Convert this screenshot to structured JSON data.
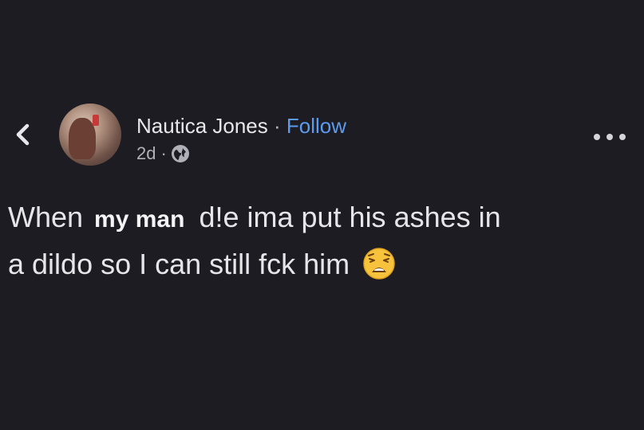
{
  "post": {
    "author": "Nautica Jones",
    "separator": "·",
    "follow_label": "Follow",
    "time": "2d",
    "meta_separator": "·",
    "privacy_icon": "globe-icon",
    "body": {
      "line1_start": "When",
      "overlay_text": "my man",
      "line1_end": "d!e ima put his ashes in",
      "line2": "a dildo so I can still fck him",
      "emoji": "weary-face-emoji"
    }
  },
  "icons": {
    "back": "chevron-left-icon",
    "more": "more-options-icon"
  },
  "colors": {
    "background": "#1d1c22",
    "text": "#e6e6ea",
    "link": "#5b9bf0",
    "muted": "#b0b0b8"
  }
}
